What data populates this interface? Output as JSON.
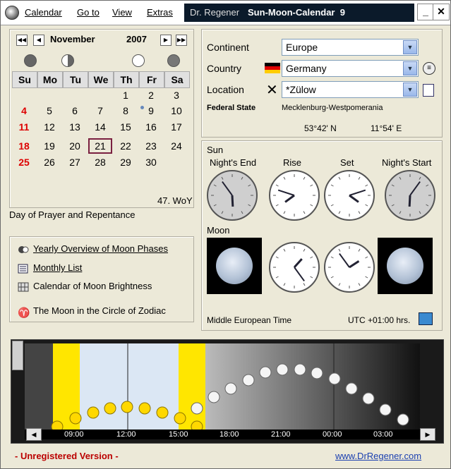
{
  "app": {
    "menu": [
      "Calendar",
      "Go to",
      "View",
      "Extras"
    ],
    "registered_to": "Dr. Regener",
    "title": "Sun-Moon-Calendar",
    "version": "9"
  },
  "calendar": {
    "month": "November",
    "year": "2007",
    "weekday_headers": [
      "Su",
      "Mo",
      "Tu",
      "We",
      "Th",
      "Fr",
      "Sa"
    ],
    "weeks": [
      [
        "",
        "",
        "",
        "",
        "1",
        "2",
        "3"
      ],
      [
        "4",
        "5",
        "6",
        "7",
        "8",
        "9",
        "10"
      ],
      [
        "11",
        "12",
        "13",
        "14",
        "15",
        "16",
        "17"
      ],
      [
        "18",
        "19",
        "20",
        "21",
        "22",
        "23",
        "24"
      ],
      [
        "25",
        "26",
        "27",
        "28",
        "29",
        "30",
        ""
      ]
    ],
    "selected_day": "21",
    "week_of_year": "47. WoY",
    "holiday": "Day of Prayer and Repentance"
  },
  "links": {
    "yearly": "Yearly Overview of Moon Phases",
    "monthly": "Monthly List",
    "brightness": "Calendar of Moon Brightness",
    "zodiac": "The Moon in the Circle of Zodiac"
  },
  "location": {
    "continent_label": "Continent",
    "continent": "Europe",
    "country_label": "Country",
    "country": "Germany",
    "location_label": "Location",
    "location": "*Zülow",
    "state_label": "Federal State",
    "state": "Mecklenburg-Westpomerania",
    "latitude": "53°42' N",
    "longitude": "11°54' E"
  },
  "sun": {
    "label": "Sun",
    "headers": [
      "Night's End",
      "Rise",
      "Set",
      "Night's Start"
    ],
    "times_hours": [
      5.9,
      7.8,
      16.2,
      18.1
    ]
  },
  "moon": {
    "label": "Moon",
    "times_hours": [
      13.4,
      1.9
    ]
  },
  "timezone": {
    "name": "Middle European Time",
    "offset": "UTC +01:00 hrs."
  },
  "sky_chart": {
    "time_ticks": [
      "09:00",
      "12:00",
      "15:00",
      "18:00",
      "21:00",
      "00:00",
      "03:00"
    ]
  },
  "footer": {
    "unregistered": "- Unregistered Version -",
    "url": "www.DrRegener.com"
  },
  "colors": {
    "weekend_red": "#dd0000",
    "link_blue": "#1a3fb0",
    "sun_yellow": "#ffe600",
    "moon_white": "#f5f5f5"
  }
}
